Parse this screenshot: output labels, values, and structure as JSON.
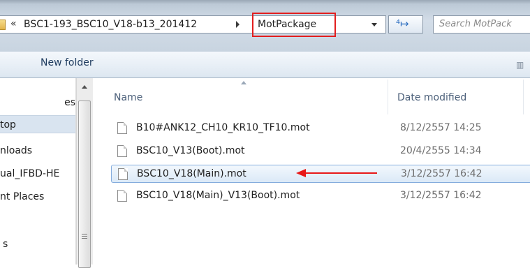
{
  "address_bar": {
    "overflow_chevron": "«",
    "crumb_parent": "BSC1-193_BSC10_V18-b13_201412",
    "crumb_current": "MotPackage",
    "refresh_glyph": "⁴↦"
  },
  "search": {
    "placeholder": "Search MotPack"
  },
  "toolbar": {
    "new_folder": "New folder",
    "view_glyph": "▥"
  },
  "nav": {
    "items": [
      {
        "label": "es"
      },
      {
        "label": "top"
      },
      {
        "label": "nloads"
      },
      {
        "label": "ual_IFBD-HE"
      },
      {
        "label": "nt Places"
      },
      {
        "label": ""
      },
      {
        "label": "s"
      }
    ]
  },
  "columns": {
    "name": "Name",
    "date_modified": "Date modified"
  },
  "files": [
    {
      "name": "B10#ANK12_CH10_KR10_TF10.mot",
      "date": "8/12/2557 14:25"
    },
    {
      "name": "BSC10_V13(Boot).mot",
      "date": "20/4/2555 14:34"
    },
    {
      "name": "BSC10_V18(Main).mot",
      "date": "3/12/2557 16:42"
    },
    {
      "name": "BSC10_V18(Main)_V13(Boot).mot",
      "date": "3/12/2557 16:42"
    }
  ],
  "colors": {
    "highlight_box": "#e21e1e",
    "annotation_arrow": "#e81818",
    "selection": "#dbe9f7"
  }
}
